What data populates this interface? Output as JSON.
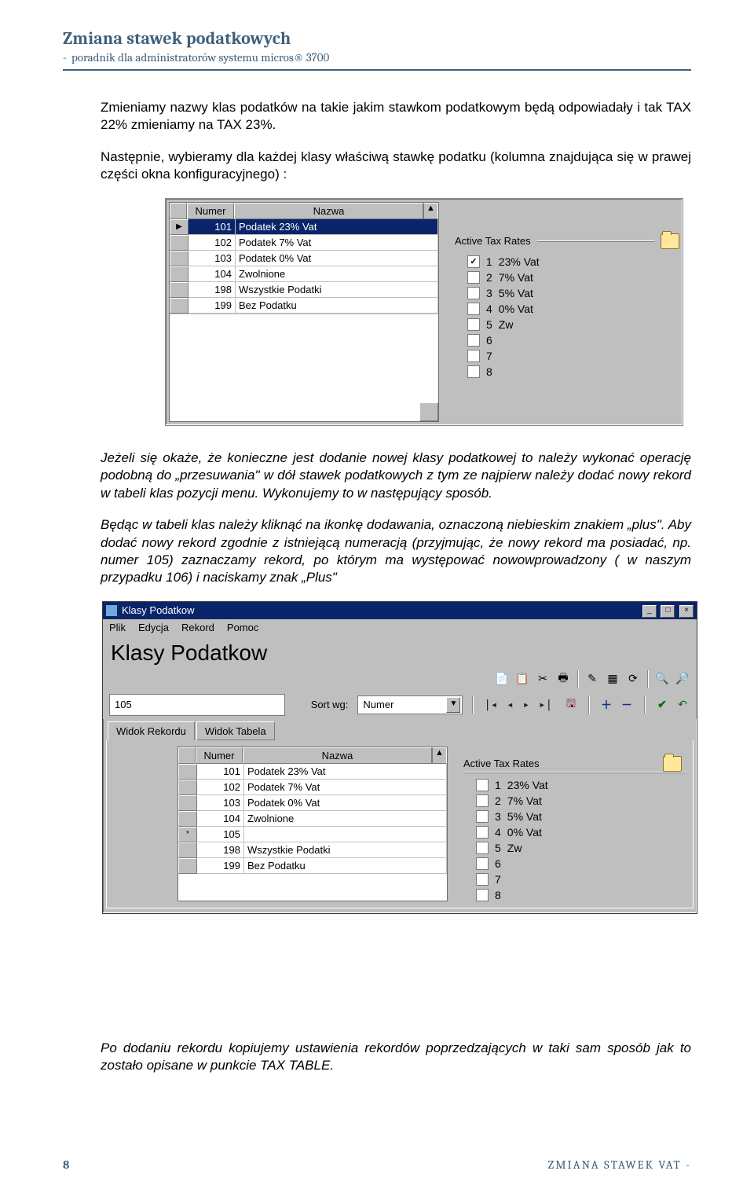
{
  "header": {
    "title": "Zmiana stawek podatkowych",
    "subtitle": "poradnik dla administratorów systemu micros® 3700"
  },
  "para1": "Zmieniamy nazwy klas podatków na takie jakim stawkom podatkowym będą odpowiadały i tak TAX 22% zmieniamy na TAX 23%.",
  "para2": "Następnie, wybieramy dla każdej klasy właściwą stawkę podatku (kolumna znajdująca się w prawej części okna konfiguracyjnego) :",
  "para3": "Jeżeli się okaże, że konieczne jest dodanie nowej klasy podatkowej to należy wykonać operację podobną do „przesuwania\" w dół stawek podatkowych z tym ze najpierw należy dodać nowy rekord w tabeli klas pozycji menu. Wykonujemy to w następujący sposób.",
  "para4": "Będąc w tabeli klas należy kliknąć na ikonkę dodawania, oznaczoną niebieskim znakiem „plus\". Aby dodać nowy rekord zgodnie z istniejącą numeracją (przyjmując, że nowy rekord ma posiadać, np. numer 105) zaznaczamy rekord, po którym ma występować nowowprowadzony ( w naszym przypadku 106) i naciskamy znak „Plus\"",
  "para5": "Po dodaniu rekordu kopiujemy ustawienia rekordów poprzedzających w taki sam sposób jak to zostało opisane w punkcie TAX TABLE.",
  "shot1": {
    "columns": {
      "num": "Numer",
      "name": "Nazwa"
    },
    "rows": [
      {
        "num": "101",
        "name": "Podatek 23% Vat"
      },
      {
        "num": "102",
        "name": "Podatek 7% Vat"
      },
      {
        "num": "103",
        "name": "Podatek 0% Vat"
      },
      {
        "num": "104",
        "name": "Zwolnione"
      },
      {
        "num": "198",
        "name": "Wszystkie Podatki"
      },
      {
        "num": "199",
        "name": "Bez Podatku"
      }
    ],
    "atr_title": "Active Tax Rates",
    "rates": [
      {
        "n": "1",
        "label": "23% Vat",
        "checked": true
      },
      {
        "n": "2",
        "label": "7% Vat",
        "checked": false
      },
      {
        "n": "3",
        "label": "5% Vat",
        "checked": false
      },
      {
        "n": "4",
        "label": "0% Vat",
        "checked": false
      },
      {
        "n": "5",
        "label": "Zw",
        "checked": false
      },
      {
        "n": "6",
        "label": "",
        "checked": false
      },
      {
        "n": "7",
        "label": "",
        "checked": false
      },
      {
        "n": "8",
        "label": "",
        "checked": false
      }
    ]
  },
  "shot2": {
    "window_title": "Klasy Podatkow",
    "menu": [
      "Plik",
      "Edycja",
      "Rekord",
      "Pomoc"
    ],
    "big_title": "Klasy Podatkow",
    "input_value": "105",
    "sort_label": "Sort wg:",
    "sort_combo": "Numer",
    "tab1": "Widok Rekordu",
    "tab2": "Widok Tabela",
    "columns": {
      "num": "Numer",
      "name": "Nazwa"
    },
    "rows": [
      {
        "marker": "",
        "num": "101",
        "name": "Podatek 23% Vat"
      },
      {
        "marker": "",
        "num": "102",
        "name": "Podatek 7% Vat"
      },
      {
        "marker": "",
        "num": "103",
        "name": "Podatek 0% Vat"
      },
      {
        "marker": "",
        "num": "104",
        "name": "Zwolnione"
      },
      {
        "marker": "*",
        "num": "105",
        "name": ""
      },
      {
        "marker": "",
        "num": "198",
        "name": "Wszystkie Podatki"
      },
      {
        "marker": "",
        "num": "199",
        "name": "Bez Podatku"
      }
    ],
    "atr_title": "Active Tax Rates",
    "rates": [
      {
        "n": "1",
        "label": "23% Vat",
        "checked": false
      },
      {
        "n": "2",
        "label": "7% Vat",
        "checked": false
      },
      {
        "n": "3",
        "label": "5% Vat",
        "checked": false
      },
      {
        "n": "4",
        "label": "0% Vat",
        "checked": false
      },
      {
        "n": "5",
        "label": "Zw",
        "checked": false
      },
      {
        "n": "6",
        "label": "",
        "checked": false
      },
      {
        "n": "7",
        "label": "",
        "checked": false
      },
      {
        "n": "8",
        "label": "",
        "checked": false
      }
    ]
  },
  "footer": {
    "page": "8",
    "right": "ZMIANA STAWEK VAT -"
  }
}
